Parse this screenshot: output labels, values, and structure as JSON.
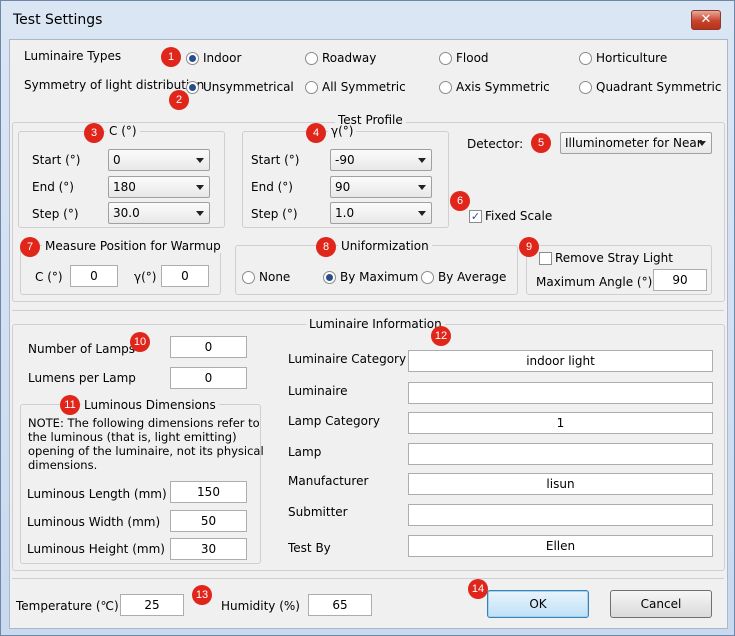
{
  "window": {
    "title": "Test Settings",
    "close_glyph": "✕"
  },
  "luminaire_types": {
    "label": "Luminaire Types",
    "options": [
      "Indoor",
      "Roadway",
      "Flood",
      "Horticulture"
    ]
  },
  "symmetry": {
    "label": "Symmetry of light distribution",
    "options": [
      "Unsymmetrical",
      "All Symmetric",
      "Axis Symmetric",
      "Quadrant Symmetric"
    ]
  },
  "test_profile": {
    "title": "Test Profile",
    "c_group": {
      "title": "C (°)",
      "start_label": "Start (°)",
      "start_value": "0",
      "end_label": "End (°)",
      "end_value": "180",
      "step_label": "Step (°)",
      "step_value": "30.0"
    },
    "gamma_group": {
      "title": "γ(°)",
      "start_label": "Start (°)",
      "start_value": "-90",
      "end_label": "End (°)",
      "end_value": "90",
      "step_label": "Step (°)",
      "step_value": "1.0"
    },
    "detector_label": "Detector:",
    "detector_value": "Illuminometer for Near F",
    "fixed_scale_label": "Fixed Scale",
    "fixed_scale_checked": true
  },
  "warmup": {
    "title": "Measure Position for Warmup",
    "c_label": "C (°)",
    "c_value": "0",
    "gamma_label": "γ(°)",
    "gamma_value": "0"
  },
  "uniformization": {
    "title": "Uniformization",
    "options": [
      "None",
      "By Maximum",
      "By Average"
    ]
  },
  "stray_light": {
    "checkbox_label": "Remove Stray Light",
    "checked": false,
    "max_angle_label": "Maximum Angle (°):",
    "max_angle_value": "90"
  },
  "luminaire_info": {
    "title": "Luminaire Information",
    "lamps_label": "Number of Lamps",
    "lamps_value": "0",
    "lumens_label": "Lumens per Lamp",
    "lumens_value": "0",
    "dims_title": "Luminous Dimensions",
    "note": [
      "NOTE: The following dimensions refer to",
      "the luminous (that is, light emitting)",
      "opening of the luminaire, not its physical",
      "dimensions."
    ],
    "length_label": "Luminous Length (mm)",
    "length_value": "150",
    "width_label": "Luminous Width (mm)",
    "width_value": "50",
    "height_label": "Luminous Height (mm)",
    "height_value": "30",
    "fields": [
      {
        "label": "Luminaire Category",
        "value": "indoor light"
      },
      {
        "label": "Luminaire",
        "value": ""
      },
      {
        "label": "Lamp Category",
        "value": "1"
      },
      {
        "label": "Lamp",
        "value": ""
      },
      {
        "label": "Manufacturer",
        "value": "lisun"
      },
      {
        "label": "Submitter",
        "value": ""
      },
      {
        "label": "Test By",
        "value": "Ellen"
      }
    ]
  },
  "environment": {
    "temperature_label": "Temperature (℃)",
    "temperature_value": "25",
    "humidity_label": "Humidity (%)",
    "humidity_value": "65"
  },
  "buttons": {
    "ok": "OK",
    "cancel": "Cancel"
  },
  "badges": [
    "1",
    "2",
    "3",
    "4",
    "5",
    "6",
    "7",
    "8",
    "9",
    "10",
    "11",
    "12",
    "13",
    "14"
  ],
  "colors": {
    "badge": "#e0251b",
    "ok_border": "#3c7fb1"
  }
}
